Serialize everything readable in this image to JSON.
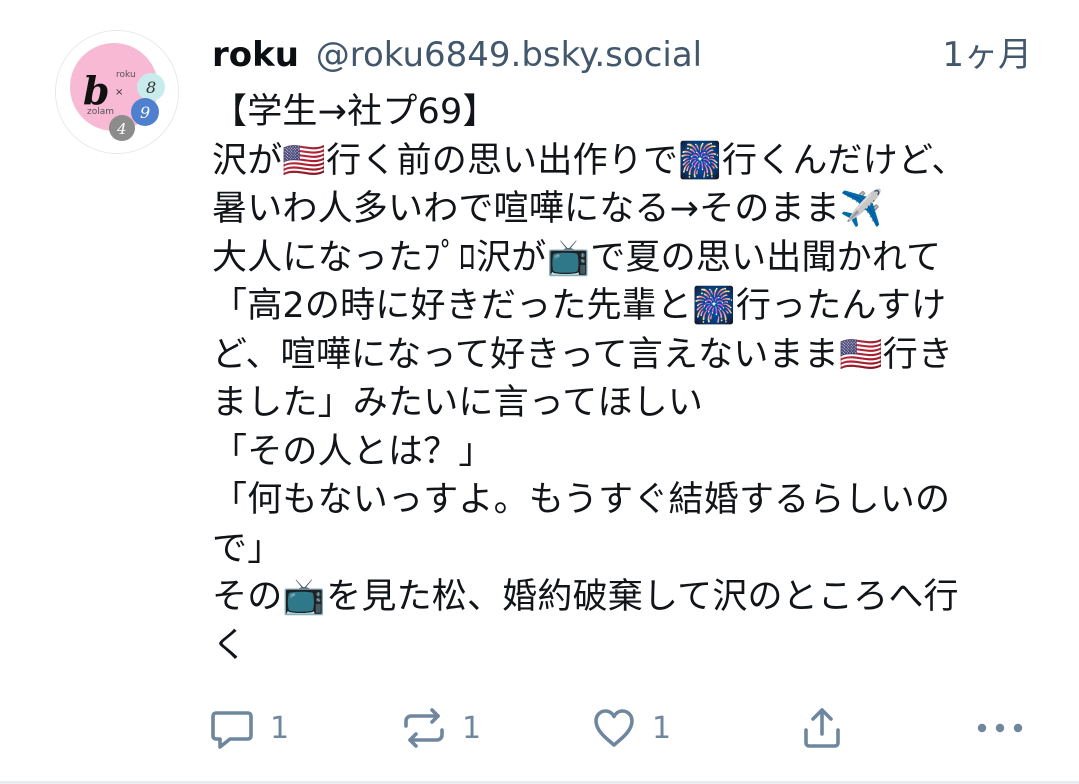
{
  "post": {
    "author": {
      "display_name": "roku",
      "handle": "@roku6849.bsky.social"
    },
    "timestamp": "1ヶ月",
    "avatar": {
      "text_top": "roku",
      "text_x": "×",
      "text_bottom": "zolam",
      "letter_b": "b",
      "digit_8": "8",
      "digit_9": "9",
      "digit_4": "4",
      "colors": {
        "pink": "#f7b9d3",
        "mint": "#c8ecec",
        "blue": "#4f7fcf",
        "gray": "#8c8c8c"
      }
    },
    "text_lines": [
      "【学生→社プ69】",
      "沢が🇺🇸行く前の思い出作りで🎆行くんだけど、",
      "暑いわ人多いわで喧嘩になる→そのまま✈️",
      "大人になったﾌﾟﾛ沢が📺で夏の思い出聞かれて",
      "「高2の時に好きだった先輩と🎆行ったんすけ",
      "ど、喧嘩になって好きって言えないまま🇺🇸行き",
      "ました」みたいに言ってほしい",
      "「その人とは？」",
      "「何もないっすよ。もうすぐ結婚するらしいの",
      "で」",
      "その📺を見た松、婚約破棄して沢のところへ行",
      "く"
    ],
    "actions": {
      "reply_count": "1",
      "repost_count": "1",
      "like_count": "1"
    },
    "icons": [
      "reply-icon",
      "repost-icon",
      "like-icon",
      "share-icon",
      "more-icon"
    ],
    "colors": {
      "icon": "#6f869f",
      "handle": "#42576c",
      "text": "#111418"
    }
  }
}
